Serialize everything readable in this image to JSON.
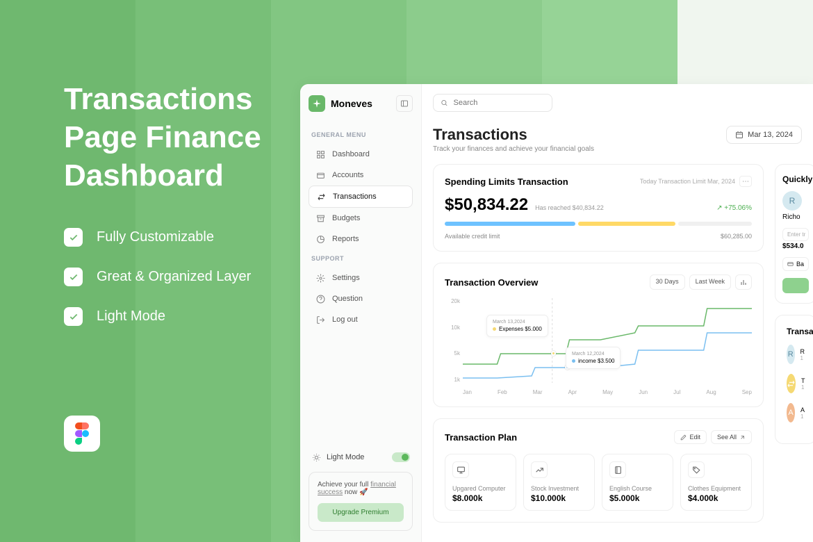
{
  "promo": {
    "title": "Transactions Page Finance Dashboard",
    "features": [
      "Fully Customizable",
      "Great & Organized Layer",
      "Light Mode"
    ]
  },
  "brand": {
    "name": "Moneves"
  },
  "sidebar": {
    "general_label": "GENERAL MENU",
    "support_label": "SUPPORT",
    "items": [
      {
        "label": "Dashboard",
        "icon": "grid-icon"
      },
      {
        "label": "Accounts",
        "icon": "wallet-icon"
      },
      {
        "label": "Transactions",
        "icon": "swap-icon"
      },
      {
        "label": "Budgets",
        "icon": "archive-icon"
      },
      {
        "label": "Reports",
        "icon": "chart-icon"
      }
    ],
    "support": [
      {
        "label": "Settings",
        "icon": "gear-icon"
      },
      {
        "label": "Question",
        "icon": "question-icon"
      },
      {
        "label": "Log out",
        "icon": "logout-icon"
      }
    ],
    "theme_label": "Light Mode",
    "upgrade_text1": "Achieve your full ",
    "upgrade_link": "financial success",
    "upgrade_text2": " now 🚀",
    "upgrade_btn": "Upgrade Premium"
  },
  "search": {
    "placeholder": "Search"
  },
  "page": {
    "title": "Transactions",
    "subtitle": "Track your finances and achieve your financial goals",
    "date_label": "Mar 13, 2024"
  },
  "spending": {
    "title": "Spending Limits Transaction",
    "meta": "Today Transaction Limit Mar, 2024",
    "amount": "$50,834.22",
    "reached_label": "Has reached $40,834.22",
    "percent": "+75.06%",
    "available_label": "Available credit limit",
    "available_value": "$60,285.00"
  },
  "overview": {
    "title": "Transaction Overview",
    "btn_30": "30 Days",
    "btn_week": "Last Week",
    "tooltip1": {
      "date": "March 13,2024",
      "label": "Expenses $5.000"
    },
    "tooltip2": {
      "date": "March 12,2024",
      "label": "income $3.500"
    },
    "y_labels": [
      "20k",
      "10k",
      "5k",
      "1k"
    ],
    "x_labels": [
      "Jan",
      "Feb",
      "Mar",
      "Apr",
      "May",
      "Jun",
      "Jul",
      "Aug",
      "Sep"
    ]
  },
  "plan": {
    "title": "Transaction Plan",
    "edit": "Edit",
    "see_all": "See All",
    "items": [
      {
        "name": "Upgared Computer",
        "amount": "$8.000k",
        "icon": "monitor-icon"
      },
      {
        "name": "Stock Investment",
        "amount": "$10.000k",
        "icon": "trend-icon"
      },
      {
        "name": "English Course",
        "amount": "$5.000k",
        "icon": "book-icon"
      },
      {
        "name": "Clothes Equipment",
        "amount": "$4.000k",
        "icon": "tag-icon"
      }
    ]
  },
  "quick": {
    "title": "Quickly",
    "name": "Richo",
    "input_label": "Enter tr",
    "amount": "$534.0",
    "method": "Ba"
  },
  "transac_side": {
    "title": "Transac",
    "rows": [
      "R",
      "T",
      "A"
    ],
    "sub": "1"
  },
  "chart_data": {
    "type": "line",
    "categories": [
      "Jan",
      "Feb",
      "Mar",
      "Apr",
      "May",
      "Jun",
      "Jul",
      "Aug",
      "Sep"
    ],
    "series": [
      {
        "name": "Expenses",
        "color": "#69b869",
        "values": [
          5000,
          5000,
          5000,
          7000,
          9000,
          9000,
          12000,
          12000,
          20000
        ]
      },
      {
        "name": "Income",
        "color": "#7abff0",
        "values": [
          1500,
          1500,
          2000,
          3500,
          3500,
          4000,
          7000,
          7000,
          12000
        ]
      }
    ],
    "ylabel": "",
    "xlabel": "",
    "ylim": [
      1000,
      20000
    ],
    "annotations": [
      {
        "date": "March 13,2024",
        "series": "Expenses",
        "value": 5000
      },
      {
        "date": "March 12,2024",
        "series": "Income",
        "value": 3500
      }
    ]
  }
}
